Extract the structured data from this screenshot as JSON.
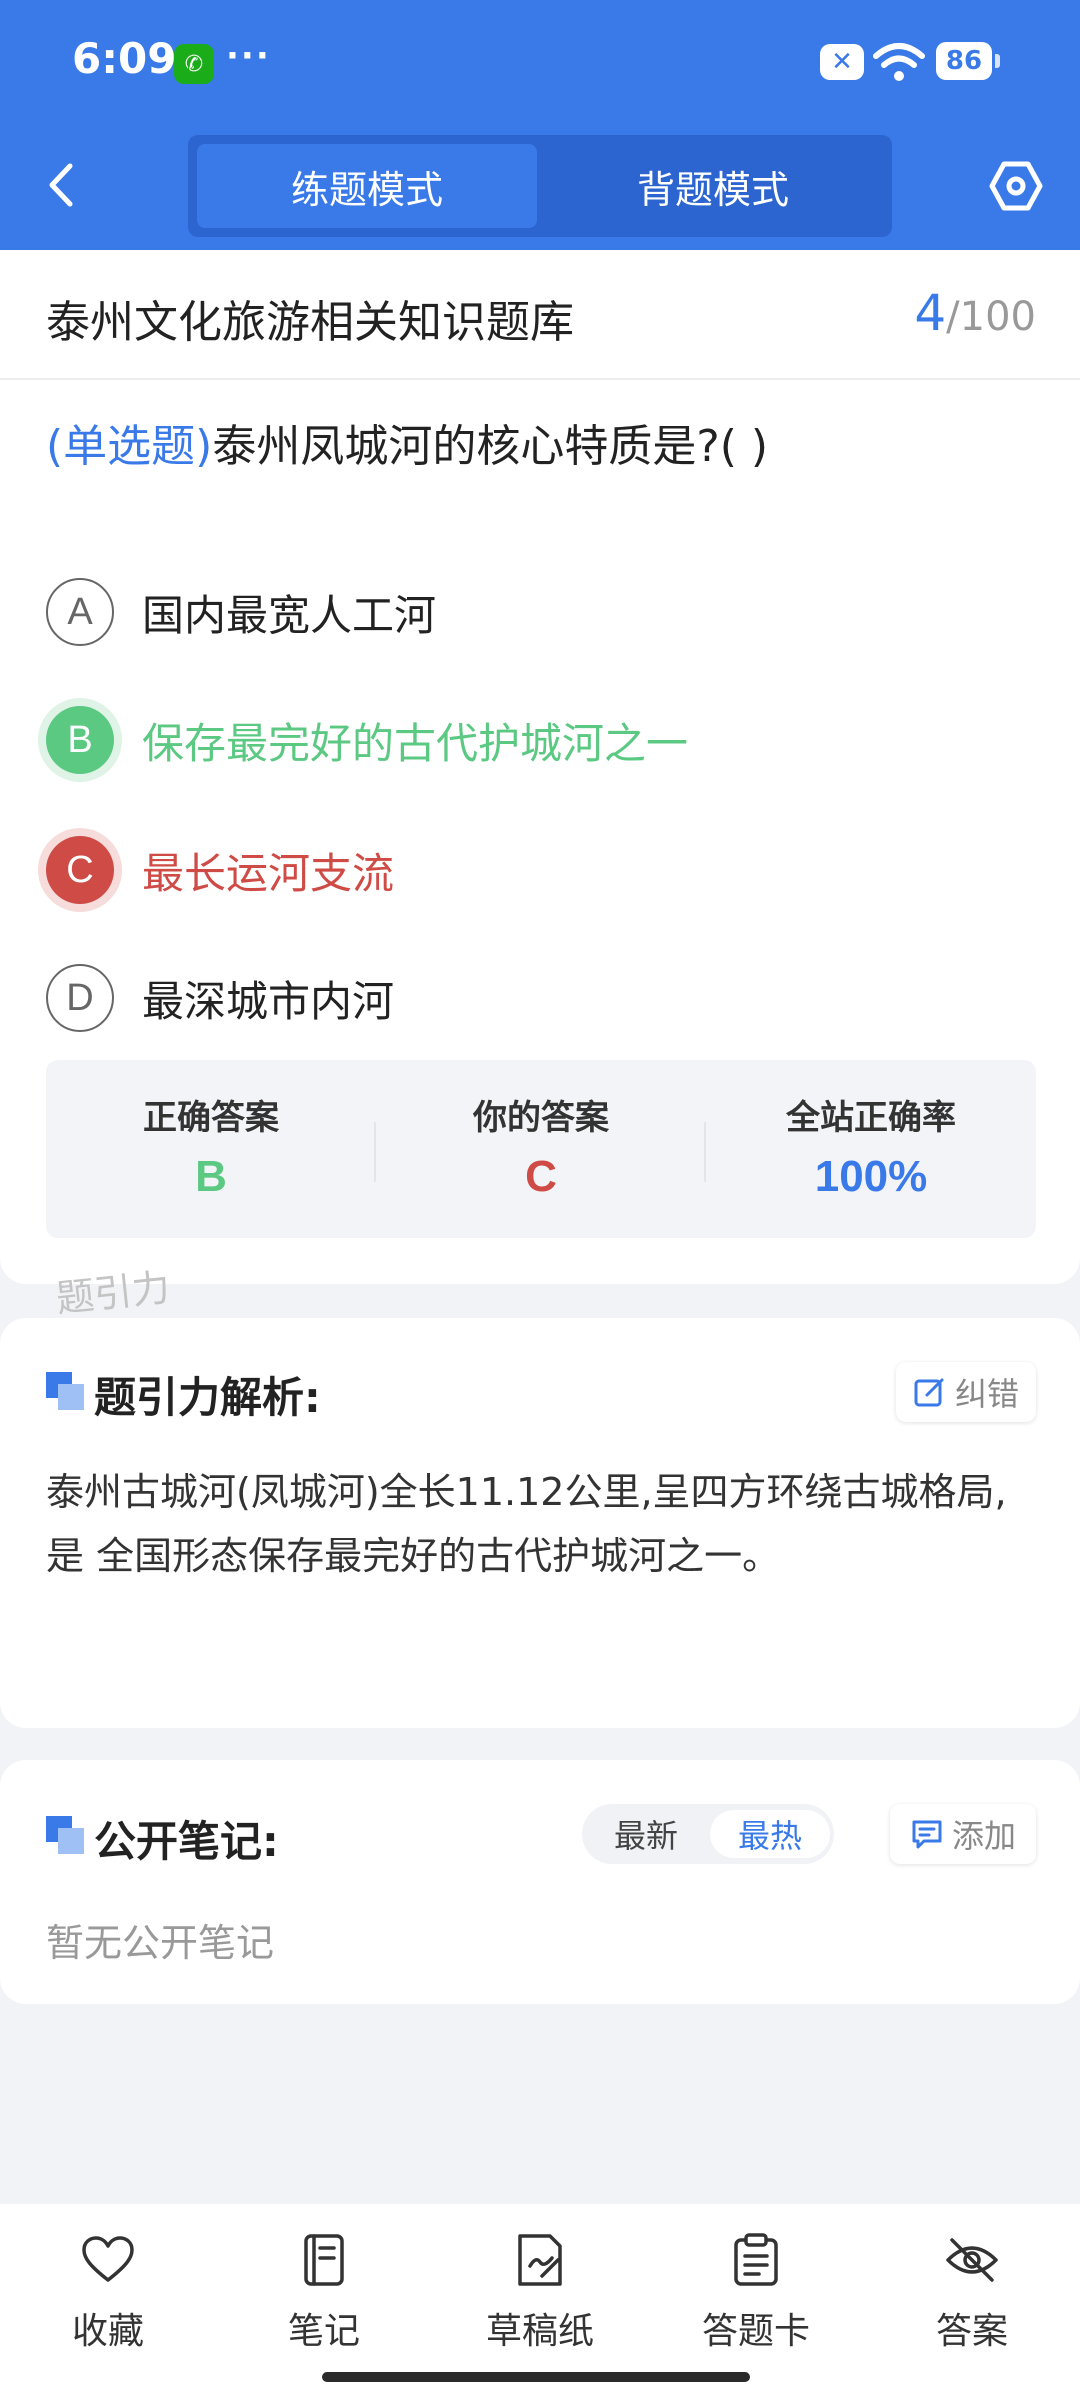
{
  "status_bar": {
    "time": "6:09",
    "dots": "···",
    "battery": "86"
  },
  "header": {
    "tabs": [
      {
        "label": "练题模式",
        "active": true
      },
      {
        "label": "背题模式",
        "active": false
      }
    ]
  },
  "quiz": {
    "bank_title": "泰州文化旅游相关知识题库",
    "current": "4",
    "total": "/100",
    "question_type": "(单选题)",
    "question_text": "泰州凤城河的核心特质是?(        )",
    "options": [
      {
        "letter": "A",
        "text": "国内最宽人工河",
        "state": "normal"
      },
      {
        "letter": "B",
        "text": "保存最完好的古代护城河之一",
        "state": "correct"
      },
      {
        "letter": "C",
        "text": "最长运河支流",
        "state": "wrong"
      },
      {
        "letter": "D",
        "text": "最深城市内河",
        "state": "normal"
      }
    ]
  },
  "stats": {
    "correct_label": "正确答案",
    "correct_value": "B",
    "yours_label": "你的答案",
    "yours_value": "C",
    "rate_label": "全站正确率",
    "rate_value": "100%"
  },
  "watermark": "题引力",
  "analysis": {
    "title": "题引力解析:",
    "report_label": "纠错",
    "text": "泰州古城河(凤城河)全长11.12公里,呈四方环绕古城格局,是 全国形态保存最完好的古代护城河之一。"
  },
  "notes": {
    "title": "公开笔记:",
    "sort_latest": "最新",
    "sort_hot": "最热",
    "add_label": "添加",
    "empty": "暂无公开笔记"
  },
  "bottom_nav": [
    {
      "label": "收藏",
      "icon": "heart-icon"
    },
    {
      "label": "笔记",
      "icon": "notebook-icon"
    },
    {
      "label": "草稿纸",
      "icon": "draft-icon"
    },
    {
      "label": "答题卡",
      "icon": "answer-sheet-icon"
    },
    {
      "label": "答案",
      "icon": "eye-off-icon"
    }
  ],
  "colors": {
    "primary": "#3a7ae8",
    "correct": "#5cc983",
    "wrong": "#cf4b45"
  }
}
